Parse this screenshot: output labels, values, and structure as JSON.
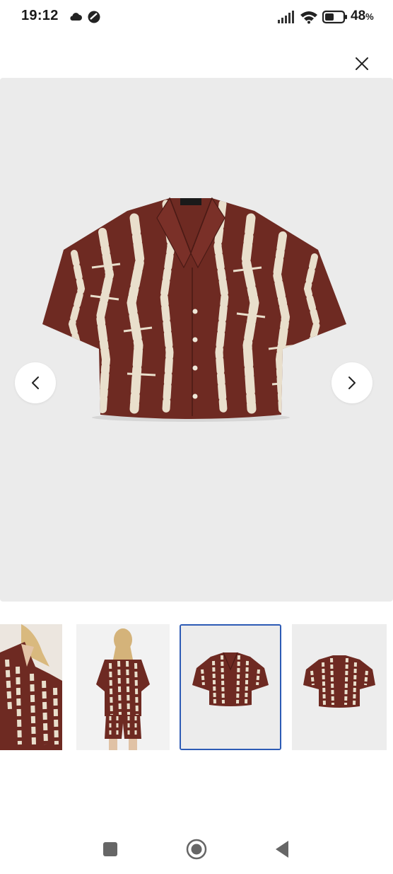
{
  "status_bar": {
    "time": "19:12",
    "battery_value": "48",
    "battery_unit": "%",
    "icons": [
      "cloud-icon",
      "do-not-disturb-icon",
      "signal-icon",
      "wifi-icon",
      "battery-icon"
    ]
  },
  "header": {
    "close_icon": "close-icon"
  },
  "gallery": {
    "main_image": "brown-white-patterned-shirt",
    "prev_icon": "chevron-left-icon",
    "next_icon": "chevron-right-icon",
    "thumbnails": [
      {
        "subject": "model-front-closeup",
        "selected": false
      },
      {
        "subject": "model-back-view",
        "selected": false
      },
      {
        "subject": "shirt-flat-front",
        "selected": true
      },
      {
        "subject": "shirt-flat-back",
        "selected": false
      }
    ]
  },
  "colors": {
    "shirt_brown": "#6e2a22",
    "shirt_stripe": "#e9dfcc",
    "image_bg": "#ebebeb",
    "thumb_selected_border": "#2d5bb5"
  },
  "system_nav": {
    "buttons": [
      "recents-icon",
      "home-icon",
      "back-icon"
    ]
  }
}
